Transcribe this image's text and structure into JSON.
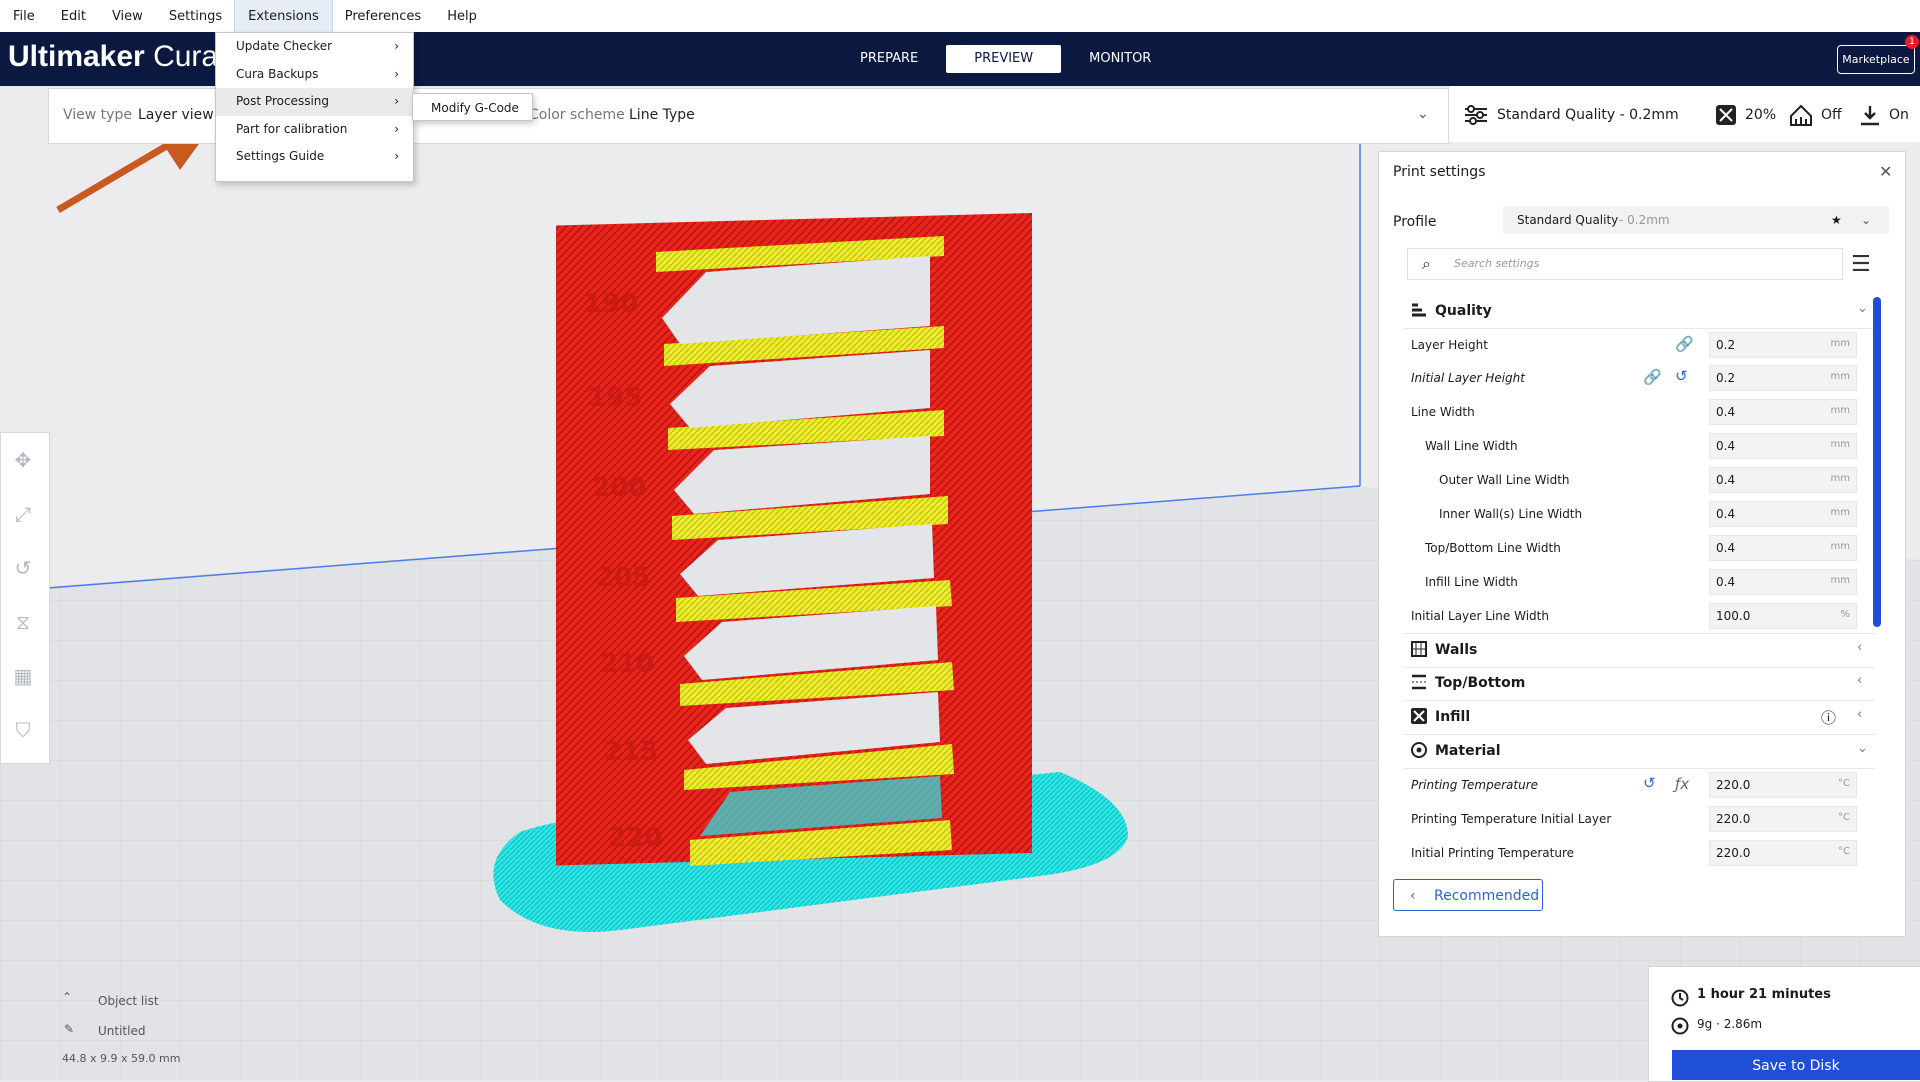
{
  "menubar": [
    "File",
    "Edit",
    "View",
    "Settings",
    "Extensions",
    "Preferences",
    "Help"
  ],
  "app": {
    "logo_bold": "Ultimaker",
    "logo_thin": "Cura"
  },
  "stages": [
    "PREPARE",
    "PREVIEW",
    "MONITOR"
  ],
  "marketplace": {
    "label": "Marketplace",
    "badge": "1"
  },
  "viewbar": {
    "view_type_label": "View type",
    "view_type_value": "Layer view",
    "color_scheme_label": "Color scheme",
    "color_scheme_value": "Line Type"
  },
  "quality_bar": {
    "profile": "Standard Quality - 0.2mm",
    "infill": "20%",
    "support": "Off",
    "adhesion": "On"
  },
  "extensions_menu": {
    "items": [
      "Update Checker",
      "Cura Backups",
      "Post Processing",
      "Part for calibration",
      "Settings Guide"
    ],
    "submenu_item": "Modify G-Code",
    "highlighted": "Post Processing"
  },
  "print_settings": {
    "title": "Print settings",
    "profile_label": "Profile",
    "profile_value": "Standard Quality",
    "profile_suffix": " - 0.2mm",
    "search_placeholder": "Search settings",
    "categories": {
      "quality": "Quality",
      "walls": "Walls",
      "topbottom": "Top/Bottom",
      "infill": "Infill",
      "material": "Material"
    },
    "settings": [
      {
        "name": "Layer Height",
        "value": "0.2",
        "unit": "mm"
      },
      {
        "name": "Initial Layer Height",
        "value": "0.2",
        "unit": "mm"
      },
      {
        "name": "Line Width",
        "value": "0.4",
        "unit": "mm"
      },
      {
        "name": "Wall Line Width",
        "value": "0.4",
        "unit": "mm"
      },
      {
        "name": "Outer Wall Line Width",
        "value": "0.4",
        "unit": "mm"
      },
      {
        "name": "Inner Wall(s) Line Width",
        "value": "0.4",
        "unit": "mm"
      },
      {
        "name": "Top/Bottom Line Width",
        "value": "0.4",
        "unit": "mm"
      },
      {
        "name": "Infill Line Width",
        "value": "0.4",
        "unit": "mm"
      },
      {
        "name": "Initial Layer Line Width",
        "value": "100.0",
        "unit": "%"
      },
      {
        "name": "Printing Temperature",
        "value": "220.0",
        "unit": "°C"
      },
      {
        "name": "Printing Temperature Initial Layer",
        "value": "220.0",
        "unit": "°C"
      },
      {
        "name": "Initial Printing Temperature",
        "value": "220.0",
        "unit": "°C"
      }
    ],
    "recommended_button": "Recommended"
  },
  "job": {
    "time": "1 hour 21 minutes",
    "material": "9g · 2.86m",
    "save_button": "Save to Disk"
  },
  "object_list": {
    "header": "Object list",
    "name": "Untitled",
    "dims": "44.8 x 9.9 x 59.0 mm"
  },
  "tower_labels": [
    "190",
    "195",
    "200",
    "205",
    "210",
    "215",
    "220"
  ],
  "colors": {
    "header": "#0b1840",
    "accent": "#1f4fd6",
    "wall": "#e8241c",
    "skin": "#e8e82a",
    "skirt": "#26e6e6",
    "arrow": "#c85a20"
  }
}
